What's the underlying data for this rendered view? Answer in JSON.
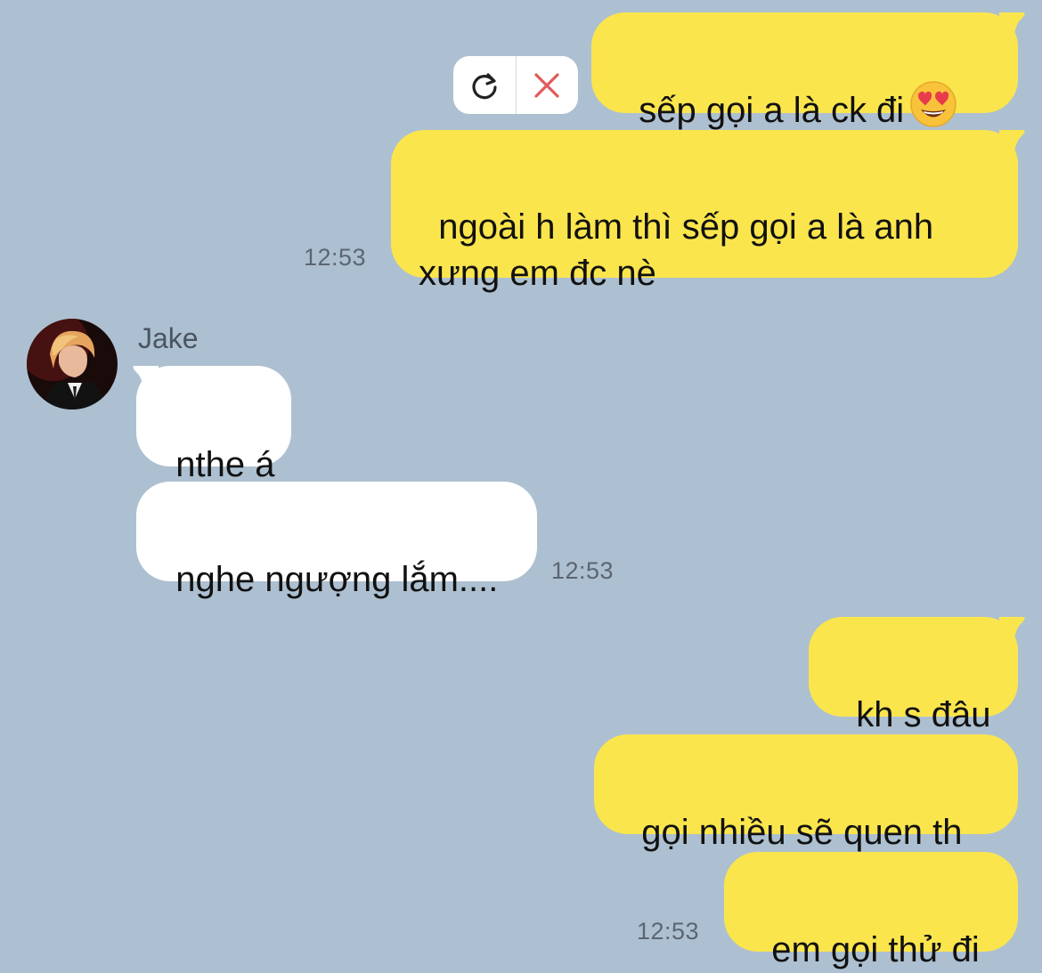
{
  "messages": {
    "m1": {
      "text": "sếp gọi a là ck đi",
      "emoji": "heart-eyes-emoji"
    },
    "m2": {
      "text": "ngoài h làm thì sếp gọi a là anh\nxưng em đc nè",
      "time": "12:53"
    },
    "m3": {
      "text": "nthe á"
    },
    "m4": {
      "text": "nghe ngượng lắm....",
      "time": "12:53"
    },
    "m5": {
      "text": "kh s đâu"
    },
    "m6": {
      "text": "gọi nhiều sẽ quen th"
    },
    "m7": {
      "text": "em gọi thử đi",
      "time": "12:53"
    }
  },
  "contact": {
    "name": "Jake"
  },
  "actions": {
    "retry_icon": "retry-icon",
    "delete_icon": "close-icon"
  },
  "colors": {
    "background": "#adc0d1",
    "outgoing": "#fbe54d",
    "incoming": "#ffffff",
    "delete": "#e25a5a"
  }
}
